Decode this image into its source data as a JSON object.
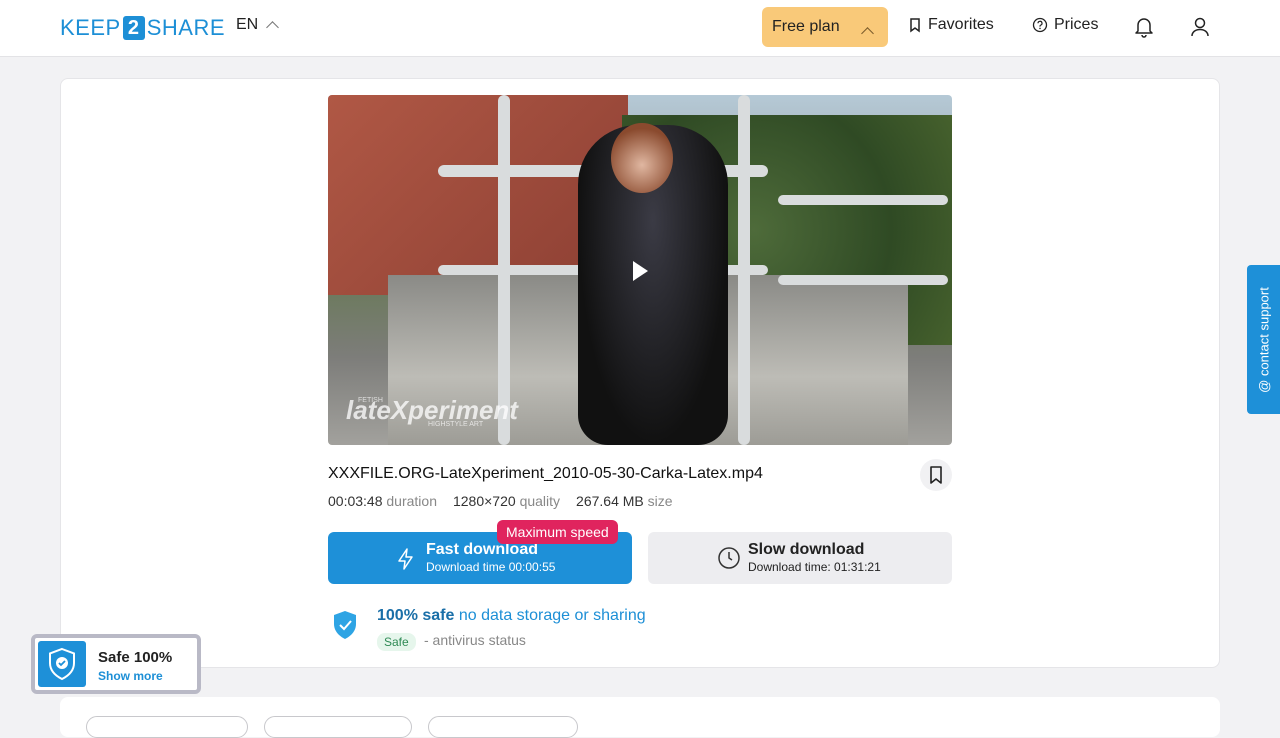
{
  "header": {
    "logo_left": "KEEP",
    "logo_mid": "2",
    "logo_right": "SHARE",
    "language": "EN",
    "free_plan_label": "Free plan",
    "favorites_label": "Favorites",
    "prices_label": "Prices"
  },
  "file": {
    "name": "XXXFILE.ORG-LateXperiment_2010-05-30-Carka-Latex.mp4",
    "duration": "00:03:48",
    "duration_label": "duration",
    "quality": "1280×720",
    "quality_label": "quality",
    "size": "267.64 MB",
    "size_label": "size"
  },
  "video": {
    "watermark": "lateXperiment",
    "watermark_small": "FETISH",
    "watermark_sub": "HIGHSTYLE ART"
  },
  "download": {
    "badge": "Maximum speed",
    "fast_label": "Fast download",
    "fast_sub": "Download time 00:00:55",
    "slow_label": "Slow download",
    "slow_sub": "Download time: 01:31:21"
  },
  "safety": {
    "bold": "100% safe",
    "rest": "no data storage or sharing",
    "badge": "Safe",
    "status": "- antivirus status"
  },
  "contact_support": "@ contact support",
  "safe_widget": {
    "title": "Safe 100%",
    "link": "Show more"
  },
  "colors": {
    "accent": "#1e90d8",
    "free_plan": "#f9c979",
    "badge_red": "#e0245e"
  }
}
